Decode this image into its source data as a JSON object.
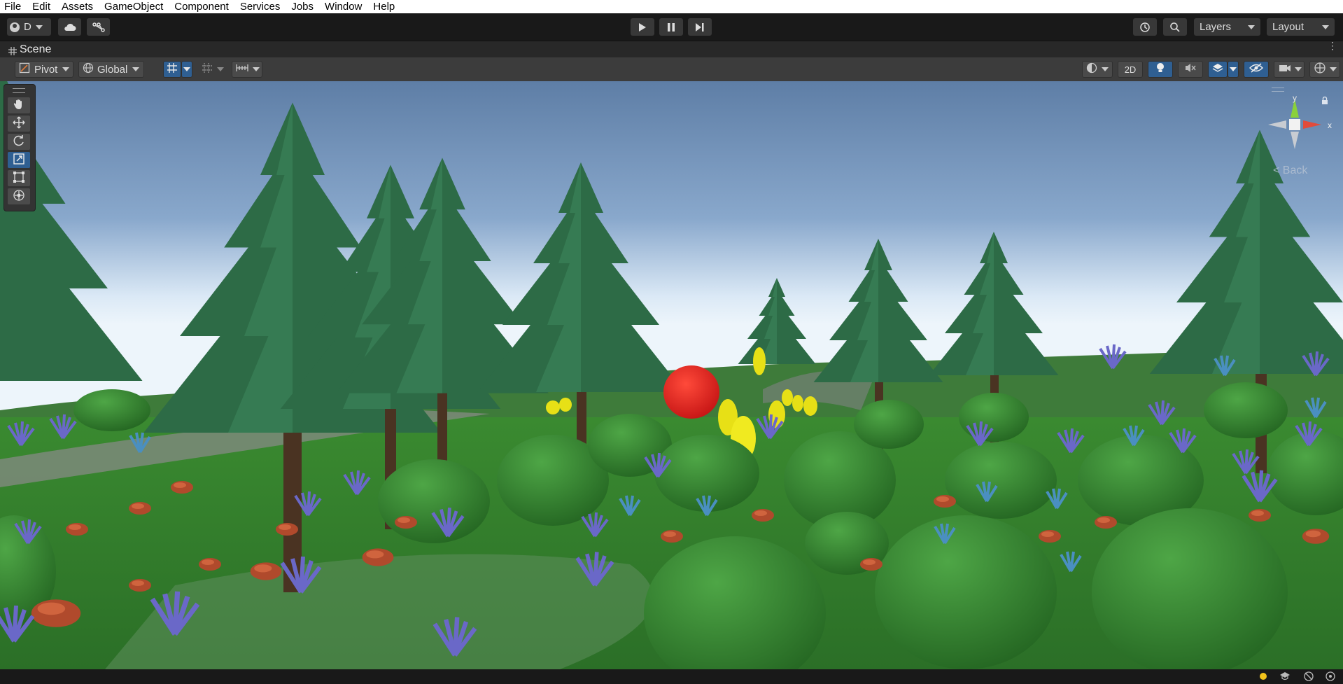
{
  "menu": [
    "File",
    "Edit",
    "Assets",
    "GameObject",
    "Component",
    "Services",
    "Jobs",
    "Window",
    "Help"
  ],
  "toolbar": {
    "account_label": "D",
    "layers_label": "Layers",
    "layout_label": "Layout"
  },
  "scene_tab": {
    "title": "Scene"
  },
  "scene_toolbar": {
    "pivot_label": "Pivot",
    "global_label": "Global",
    "mode_2d_label": "2D"
  },
  "gizmo": {
    "y_label": "y",
    "x_label": "x",
    "view_label": "< Back"
  },
  "colors": {
    "accent": "#2f5f92",
    "sky_top": "#5f7fa6",
    "sky_horizon": "#e8f1fa",
    "ground": "#2f7a2b",
    "sphere": "#e02020",
    "capsule": "#e8e218"
  }
}
